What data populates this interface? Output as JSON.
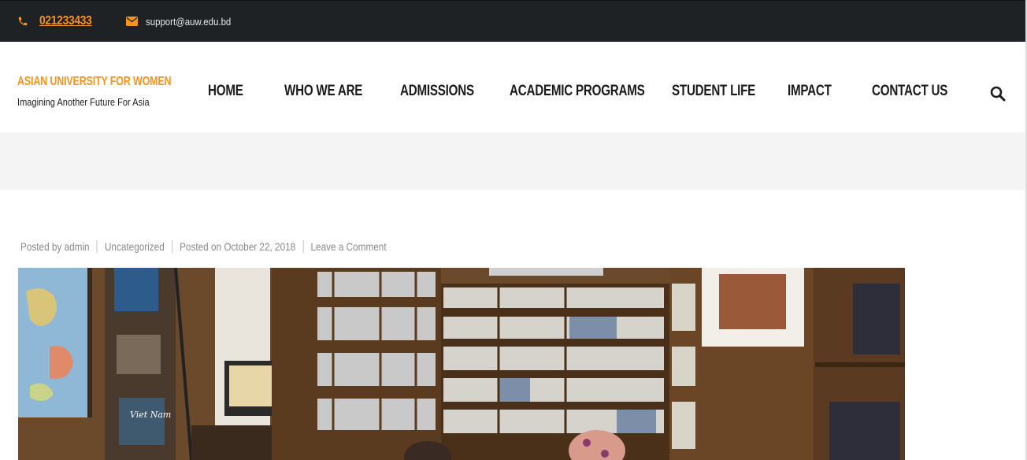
{
  "topbar": {
    "phone": "021233433",
    "email": "support@auw.edu.bd",
    "icons": {
      "phone": "phone-icon",
      "email": "envelope-icon"
    }
  },
  "brand": {
    "title": "ASIAN UNIVERSITY FOR WOMEN",
    "tagline": "Imagining Another Future For Asia"
  },
  "nav": {
    "items": [
      {
        "label": "HOME"
      },
      {
        "label": "WHO WE ARE"
      },
      {
        "label": "ADMISSIONS"
      },
      {
        "label": "ACADEMIC PROGRAMS"
      },
      {
        "label": "STUDENT LIFE"
      },
      {
        "label": "IMPACT"
      },
      {
        "label": "CONTACT US"
      }
    ],
    "search_icon": "search-icon"
  },
  "post_meta": {
    "posted_by_prefix": "Posted by",
    "author": "admin",
    "category": "Uncategorized",
    "posted_on": "Posted on October 22, 2018",
    "comment_link": "Leave a Comment"
  },
  "featured_image": {
    "subject": "library-interior-photo",
    "book_cover_text": "Viet Nam"
  },
  "colors": {
    "accent": "#f7931e",
    "topbar_bg": "#1f2225",
    "nav_text": "#1b1b1b",
    "band_bg": "#f4f4f4",
    "meta_text": "#8a8a8a"
  }
}
